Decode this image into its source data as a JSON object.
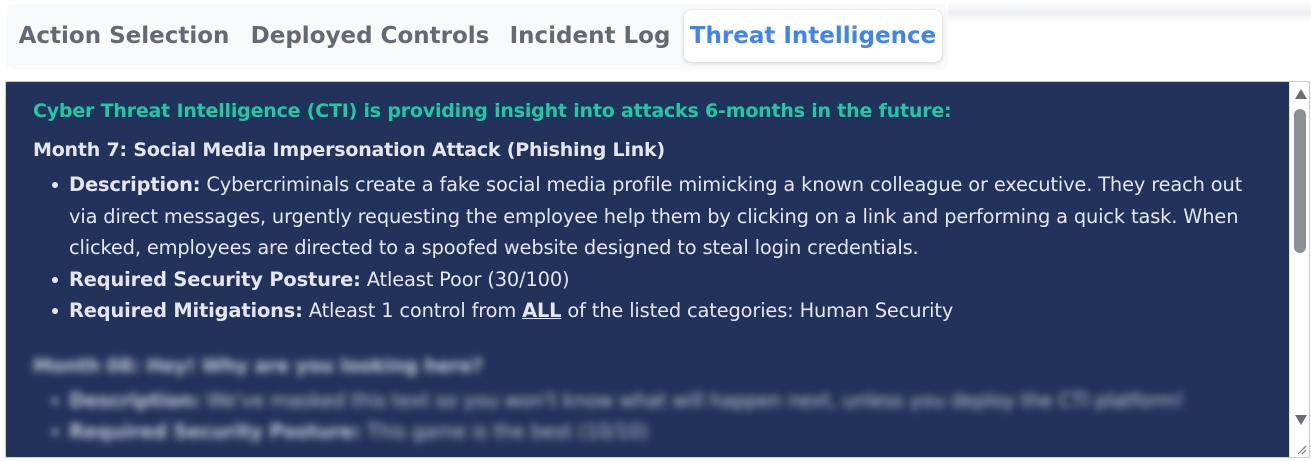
{
  "tabs": [
    {
      "label": "Action Selection",
      "active": false
    },
    {
      "label": "Deployed Controls",
      "active": false
    },
    {
      "label": "Incident Log",
      "active": false
    },
    {
      "label": "Threat Intelligence",
      "active": true
    }
  ],
  "panel": {
    "heading": "Cyber Threat Intelligence (CTI) is providing insight into attacks 6-months in the future:",
    "month": {
      "title": "Month 7: Social Media Impersonation Attack (Phishing Link)",
      "description_label": "Description:",
      "description": " Cybercriminals create a fake social media profile mimicking a known colleague or executive. They reach out via direct messages, urgently requesting the employee help them by clicking on a link and performing a quick task. When clicked, employees are directed to a spoofed website designed to steal login credentials.",
      "posture_label": "Required Security Posture:",
      "posture": " Atleast Poor (30/100)",
      "mitigations_label": "Required Mitigations:",
      "mitigations_pre": " Atleast 1 control from ",
      "mitigations_emph": "ALL",
      "mitigations_post": " of the listed categories: Human Security"
    },
    "hidden_month": {
      "title": "Month 08: Hey! Why are you looking here?",
      "description_label": "Description:",
      "description": " We've masked this text so you won't know what will happen next, unless you deploy the CTI platform!",
      "posture_label": "Required Security Posture:",
      "posture": " This game is the best (10/10)"
    }
  },
  "colors": {
    "panel_bg": "#22325a",
    "heading": "#1ec9a5",
    "active_tab": "#3f83f8",
    "inactive_tab": "#646a73"
  }
}
